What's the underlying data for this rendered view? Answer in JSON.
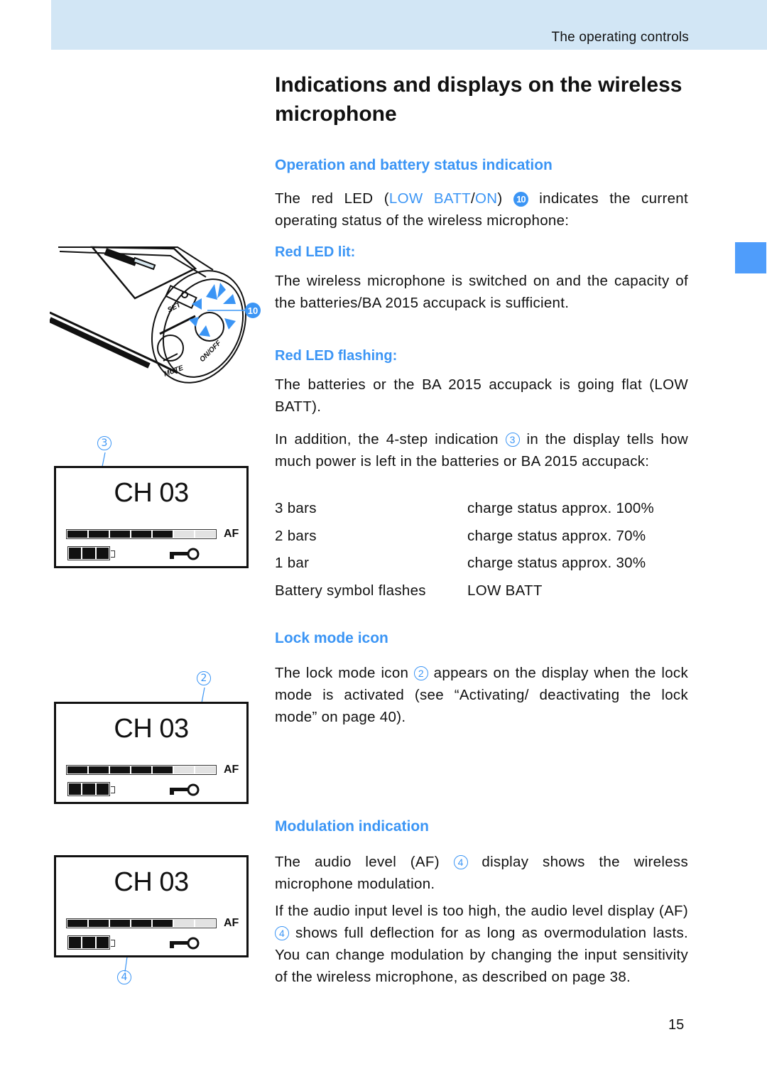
{
  "header": {
    "section_title": "The operating controls"
  },
  "side_tab": {
    "color": "#4f9dfb"
  },
  "page": {
    "title": "Indications and displays on the wireless microphone",
    "number": "15"
  },
  "sections": {
    "operation": {
      "heading": "Operation and battery status indication",
      "intro_part1": "The red LED (",
      "intro_low_batt": "LOW BATT",
      "intro_slash": "/",
      "intro_on": "ON",
      "intro_part2": ") ",
      "intro_ref": "10",
      "intro_part3": " indicates the current operating status of the wireless microphone:",
      "lit_heading": "Red LED lit:",
      "lit_text": "The wireless microphone is switched on and the capacity of the batteries/BA 2015 accupack is sufficient.",
      "flashing_heading": "Red LED flashing:",
      "flashing_text": "The batteries or the BA 2015 accupack is going flat (LOW  BATT).",
      "steps_part1": "In addition, the 4-step indication ",
      "steps_ref": "3",
      "steps_part2": " in the display tells how much power is left in the batteries or BA 2015 accupack:",
      "charge_table": [
        {
          "bars": "3 bars",
          "status": "charge status approx. 100%"
        },
        {
          "bars": "2 bars",
          "status": "charge status approx. 70%"
        },
        {
          "bars": "1 bar",
          "status": "charge status approx. 30%"
        },
        {
          "bars": "Battery symbol flashes",
          "status": "LOW BATT"
        }
      ]
    },
    "lock": {
      "heading": "Lock mode icon",
      "text_part1": "The lock mode icon ",
      "text_ref": "2",
      "text_part2": " appears on the display when the lock mode is activated (see “Activating/ deactivating the lock mode” on page 40)."
    },
    "modulation": {
      "heading": "Modulation indication",
      "p1_part1": "The audio level (AF) ",
      "p1_ref": "4",
      "p1_part2": " display shows the wireless microphone modulation.",
      "p2_part1": "If the audio input level is too high, the audio level display (AF) ",
      "p2_ref": "4",
      "p2_part2": " shows full deflection for as long as overmodulation lasts. You can change modulation by changing the input sensitivity of the wireless microphone, as described on page 38."
    }
  },
  "illustrations": {
    "microphone": {
      "callout": "10",
      "labels": {
        "set": "SET",
        "on_off": "ON/OFF",
        "mute": "MUTE"
      }
    },
    "displays": [
      {
        "callout": "3",
        "channel": "CH 03",
        "af_label": "AF",
        "af_segments_total": 7,
        "af_segments_lit": 5,
        "battery_bars": 3,
        "lock_icon": true
      },
      {
        "callout": "2",
        "channel": "CH 03",
        "af_label": "AF",
        "af_segments_total": 7,
        "af_segments_lit": 5,
        "battery_bars": 3,
        "lock_icon": true
      },
      {
        "callout": "4",
        "channel": "CH 03",
        "af_label": "AF",
        "af_segments_total": 7,
        "af_segments_lit": 5,
        "battery_bars": 3,
        "lock_icon": true
      }
    ]
  }
}
